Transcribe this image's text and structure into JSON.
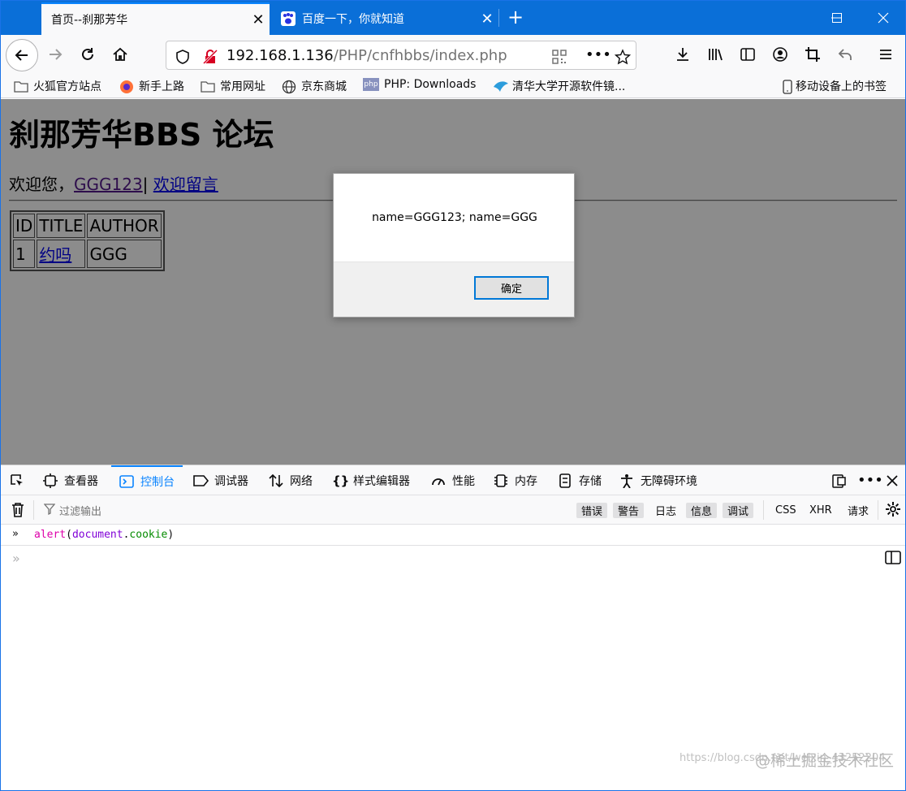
{
  "tabs": [
    {
      "title": "首页--刹那芳华",
      "active": true
    },
    {
      "title": "百度一下，你就知道",
      "active": false
    }
  ],
  "url": {
    "host": "192.168.1.136",
    "path": "/PHP/cnfhbbs/index.php"
  },
  "bookmarks": [
    "火狐官方站点",
    "新手上路",
    "常用网址",
    "京东商城",
    "PHP: Downloads",
    "清华大学开源软件镜...",
    "移动设备上的书签"
  ],
  "page": {
    "heading": "刹那芳华BBS 论坛",
    "welcome_prefix": "欢迎您，",
    "username_link": "GGG123",
    "separator": "|",
    "guestbook_link": "欢迎留言",
    "table": {
      "headers": [
        "ID",
        "TITLE",
        "AUTHOR"
      ],
      "rows": [
        [
          "1",
          "约吗",
          "GGG"
        ]
      ]
    }
  },
  "dialog": {
    "message": "name=GGG123; name=GGG",
    "ok_label": "确定"
  },
  "devtools": {
    "tabs": [
      "查看器",
      "控制台",
      "调试器",
      "网络",
      "样式编辑器",
      "性能",
      "内存",
      "存储",
      "无障碍环境"
    ],
    "active_tab": "控制台",
    "filter_placeholder": "过滤输出",
    "levels": [
      "错误",
      "警告",
      "日志",
      "信息",
      "调试"
    ],
    "types": [
      "CSS",
      "XHR",
      "请求"
    ],
    "command": {
      "fn": "alert",
      "obj": "document",
      "prop": "cookie"
    }
  },
  "watermark": {
    "url": "https://blog.csdn.net/weixin_43252204",
    "brand": "@稀土掘金技术社区"
  }
}
